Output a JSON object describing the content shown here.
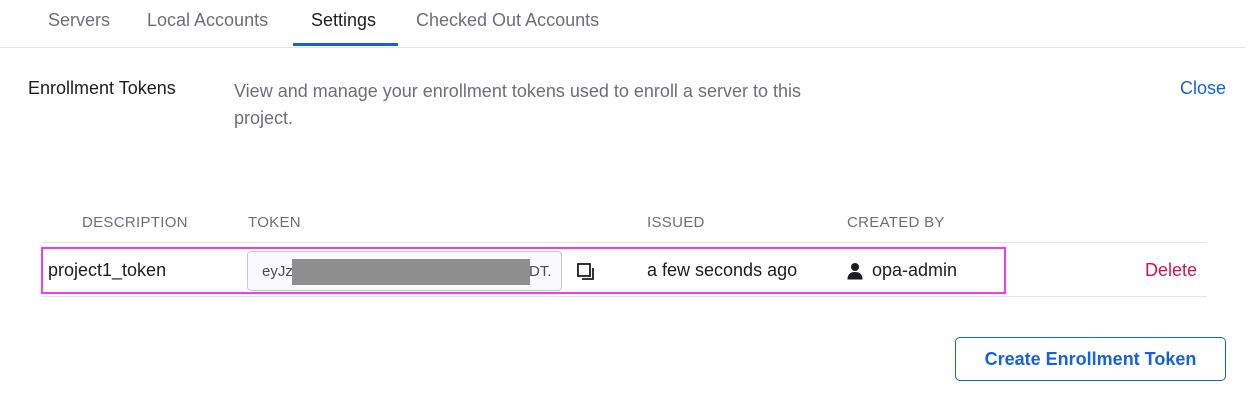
{
  "tabs": [
    {
      "label": "Servers",
      "active": false
    },
    {
      "label": "Local Accounts",
      "active": false
    },
    {
      "label": "Settings",
      "active": true
    },
    {
      "label": "Checked Out Accounts",
      "active": false
    }
  ],
  "section": {
    "title": "Enrollment Tokens",
    "description": "View and manage your enrollment tokens used to enroll a server to this project.",
    "close_label": "Close"
  },
  "table": {
    "headers": {
      "description": "DESCRIPTION",
      "token": "TOKEN",
      "issued": "ISSUED",
      "created_by": "CREATED BY"
    },
    "rows": [
      {
        "description": "project1_token",
        "token_visible_start": "eyJz",
        "token_visible_end": "DT.",
        "issued": "a few seconds ago",
        "created_by": "opa-admin",
        "delete_label": "Delete",
        "copy_icon": "copy-icon",
        "user_icon": "user-icon"
      }
    ]
  },
  "actions": {
    "create_label": "Create Enrollment Token"
  },
  "colors": {
    "accent": "#1662dd",
    "danger": "#d6124e",
    "highlight": "#f03df0",
    "redaction": "#8e8e8e"
  }
}
